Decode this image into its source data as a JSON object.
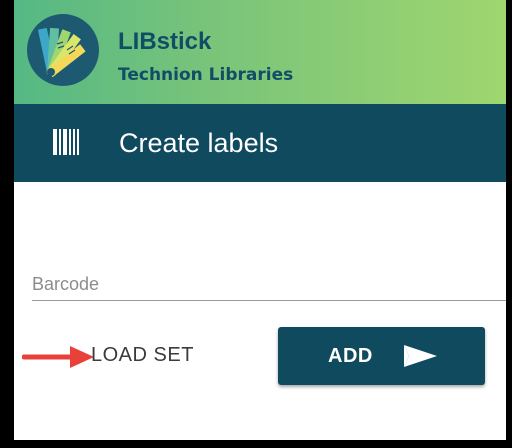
{
  "header": {
    "app_name": "LIBstick",
    "org_name": "Technion Libraries"
  },
  "toolbar": {
    "icon": "barcode-icon",
    "title": "Create labels"
  },
  "form": {
    "barcode_placeholder": "Barcode",
    "barcode_value": "",
    "load_set_label": "LOAD SET",
    "add_label": "ADD",
    "add_icon": "send-icon"
  },
  "annotation": {
    "icon": "red-arrow-icon",
    "color": "#e8413a"
  },
  "colors": {
    "header_green": "#79c47a",
    "toolbar_teal": "#0f4a5f",
    "brand_text": "#124d66"
  }
}
